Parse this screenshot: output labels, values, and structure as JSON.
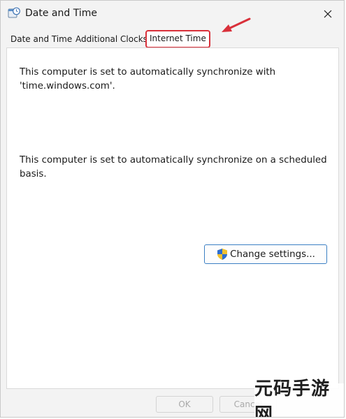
{
  "window": {
    "title": "Date and Time",
    "close_glyph": "✕"
  },
  "tabs": [
    {
      "label": "Date and Time",
      "active": false
    },
    {
      "label": "Additional Clocks",
      "active": false
    },
    {
      "label": "Internet Time",
      "active": true
    }
  ],
  "panel": {
    "sync_text": "This computer is set to automatically synchronize with 'time.windows.com'.",
    "schedule_text": "This computer is set to automatically synchronize on a scheduled basis.",
    "change_settings_label": "Change settings..."
  },
  "footer": {
    "ok_label": "OK",
    "cancel_label": "Cancel"
  },
  "watermark": {
    "text": "元码手游网"
  },
  "colors": {
    "highlight_border": "#d9303a",
    "annotation_arrow": "#d9303a",
    "button_border": "#3b7fc4"
  }
}
